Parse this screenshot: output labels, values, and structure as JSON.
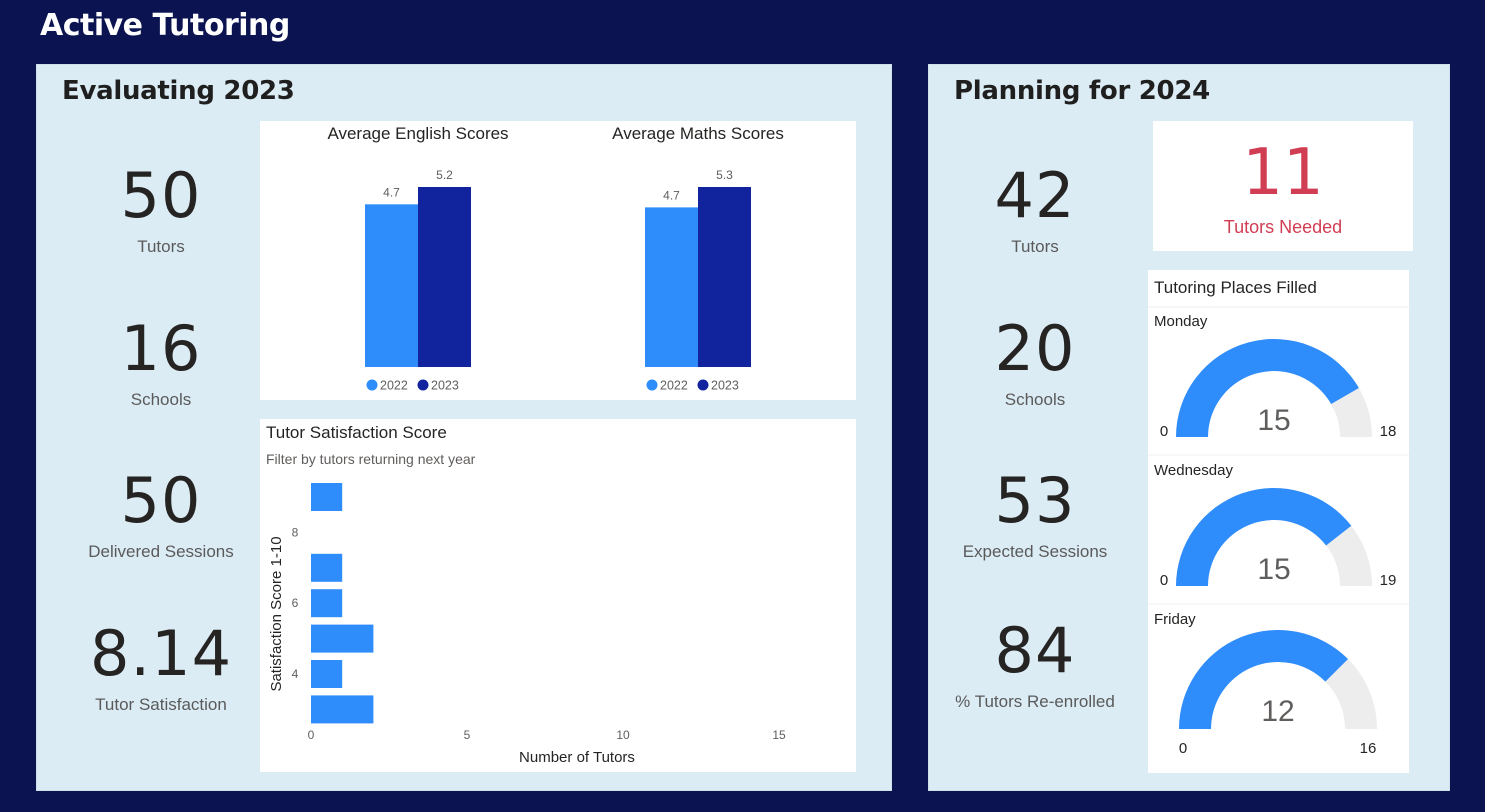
{
  "page_title": "Active Tutoring",
  "colors": {
    "background": "#0b1450",
    "panel": "#dcecf5",
    "series_2022": "#2e8cfb",
    "series_2023": "#12239e",
    "gauge_empty": "#ededed",
    "alert": "#d13d52"
  },
  "left_panel": {
    "title": "Evaluating 2023",
    "kpis": [
      {
        "value": "50",
        "label": "Tutors"
      },
      {
        "value": "16",
        "label": "Schools"
      },
      {
        "value": "50",
        "label": "Delivered Sessions"
      },
      {
        "value": "8.14",
        "label": "Tutor Satisfaction"
      }
    ]
  },
  "right_panel": {
    "title": "Planning for 2024",
    "kpis": [
      {
        "value": "42",
        "label": "Tutors"
      },
      {
        "value": "20",
        "label": "Schools"
      },
      {
        "value": "53",
        "label": "Expected Sessions"
      },
      {
        "value": "84",
        "label": "% Tutors Re-enrolled"
      }
    ],
    "tutors_needed": {
      "value": "11",
      "label": "Tutors Needed"
    },
    "places_filled": {
      "title": "Tutoring Places Filled",
      "gauges": [
        {
          "day": "Monday",
          "value": 15,
          "min": 0,
          "max": 18,
          "value_label": "15",
          "min_label": "0",
          "max_label": "18"
        },
        {
          "day": "Wednesday",
          "value": 15,
          "min": 0,
          "max": 19,
          "value_label": "15",
          "min_label": "0",
          "max_label": "19"
        },
        {
          "day": "Friday",
          "value": 12,
          "min": 0,
          "max": 16,
          "value_label": "12",
          "min_label": "0",
          "max_label": "16"
        }
      ]
    }
  },
  "chart_data": [
    {
      "type": "bar",
      "title": "Average English Scores",
      "categories": [
        ""
      ],
      "series": [
        {
          "name": "2022",
          "values": [
            4.7
          ]
        },
        {
          "name": "2023",
          "values": [
            5.2
          ]
        }
      ],
      "data_labels": [
        "4.7",
        "5.2"
      ],
      "ylim": [
        0,
        5.2
      ],
      "legend": "bottom"
    },
    {
      "type": "bar",
      "title": "Average Maths Scores",
      "categories": [
        ""
      ],
      "series": [
        {
          "name": "2022",
          "values": [
            4.7
          ]
        },
        {
          "name": "2023",
          "values": [
            5.3
          ]
        }
      ],
      "data_labels": [
        "4.7",
        "5.3"
      ],
      "ylim": [
        0,
        5.3
      ],
      "legend": "bottom"
    },
    {
      "type": "bar",
      "orientation": "horizontal",
      "title": "Tutor Satisfaction Score",
      "subtitle": "Filter by tutors returning next year",
      "xlabel": "Number of Tutors",
      "ylabel": "Satisfaction Score 1-10",
      "categories": [
        9,
        7,
        6,
        5,
        4,
        3
      ],
      "values": [
        1,
        1,
        1,
        2,
        1,
        2
      ],
      "xlim": [
        0,
        17
      ],
      "x_ticks": [
        "0",
        "5",
        "10",
        "15"
      ],
      "x_tick_values": [
        0,
        5,
        10,
        15
      ],
      "y_ticks": [
        "8",
        "6",
        "4"
      ],
      "y_tick_values": [
        8,
        6,
        4
      ],
      "ylim": [
        2.5,
        9.5
      ]
    }
  ]
}
